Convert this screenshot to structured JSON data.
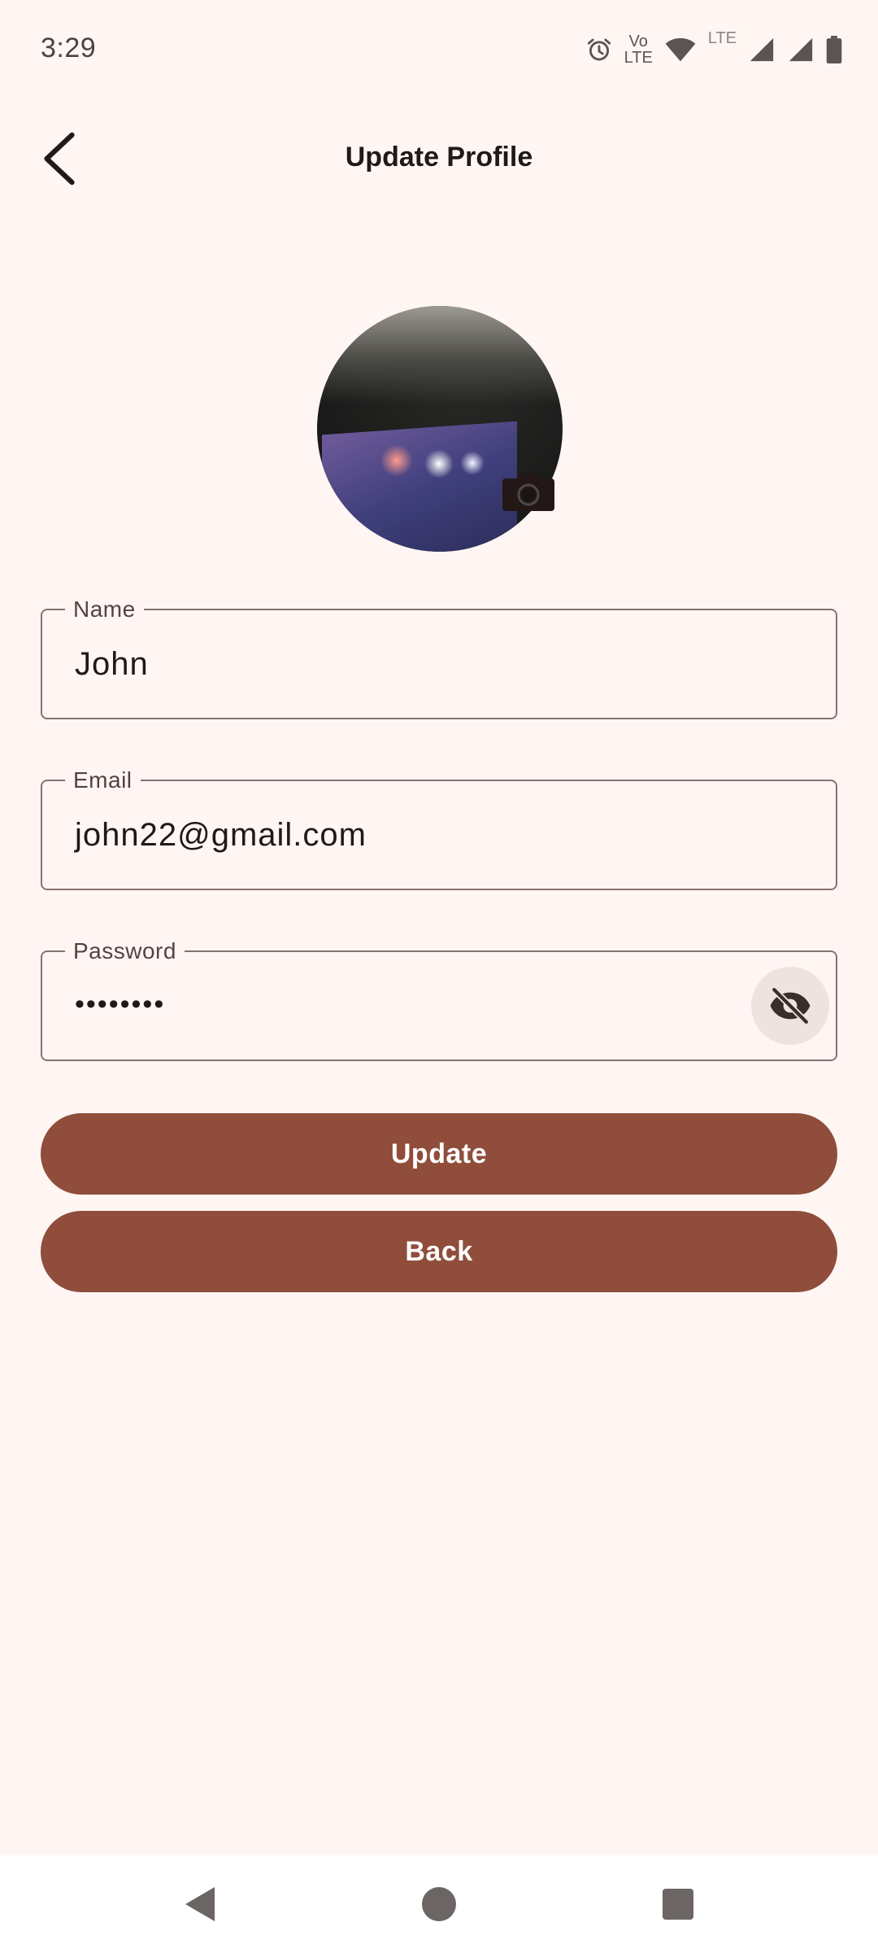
{
  "status_bar": {
    "time": "3:29",
    "volte_top": "Vo",
    "volte_bottom": "LTE",
    "network_label": "LTE",
    "icons": [
      "alarm-icon",
      "volte-icon",
      "wifi-icon",
      "signal-icon",
      "signal-icon",
      "battery-icon"
    ]
  },
  "header": {
    "title": "Update Profile",
    "back_icon": "arrow-back-icon"
  },
  "avatar": {
    "badge_icon": "camera-icon"
  },
  "form": {
    "name": {
      "label": "Name",
      "value": "John"
    },
    "email": {
      "label": "Email",
      "value": "john22@gmail.com"
    },
    "password": {
      "label": "Password",
      "value": "••••••••",
      "toggle_icon": "visibility-off-icon"
    }
  },
  "buttons": {
    "update_label": "Update",
    "back_label": "Back"
  },
  "colors": {
    "background": "#fff6f4",
    "primary": "#904d3b",
    "on_primary": "#ffffff",
    "outline": "#857370",
    "toggle_bg": "#efe3e0"
  },
  "system_nav": {
    "icons": [
      "nav-back-icon",
      "nav-home-icon",
      "nav-recents-icon"
    ]
  }
}
